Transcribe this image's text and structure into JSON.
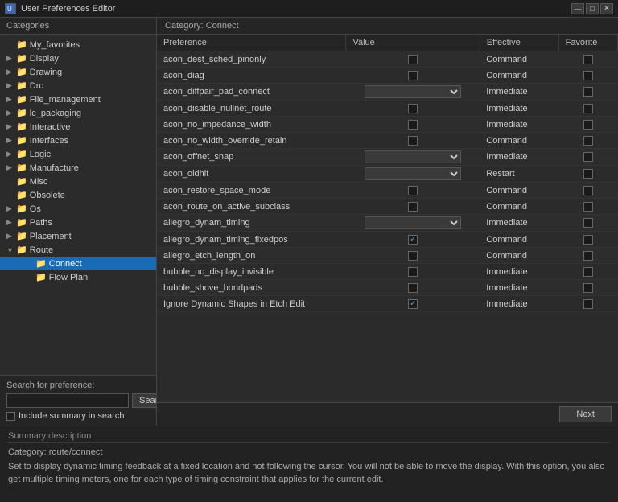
{
  "window": {
    "title": "User Preferences Editor",
    "controls": [
      "—",
      "□",
      "✕"
    ]
  },
  "sidebar": {
    "header": "Categories",
    "items": [
      {
        "id": "my_favorites",
        "label": "My_favorites",
        "indent": 1,
        "arrow": "",
        "type": "folder-yellow"
      },
      {
        "id": "display",
        "label": "Display",
        "indent": 1,
        "arrow": "▶",
        "type": "folder-yellow"
      },
      {
        "id": "drawing",
        "label": "Drawing",
        "indent": 1,
        "arrow": "▶",
        "type": "folder-yellow"
      },
      {
        "id": "drc",
        "label": "Drc",
        "indent": 1,
        "arrow": "▶",
        "type": "folder-yellow"
      },
      {
        "id": "file_management",
        "label": "File_management",
        "indent": 1,
        "arrow": "▶",
        "type": "folder-yellow"
      },
      {
        "id": "lc_packaging",
        "label": "lc_packaging",
        "indent": 1,
        "arrow": "▶",
        "type": "folder-yellow"
      },
      {
        "id": "interactive",
        "label": "Interactive",
        "indent": 1,
        "arrow": "▶",
        "type": "folder-yellow"
      },
      {
        "id": "interfaces",
        "label": "Interfaces",
        "indent": 1,
        "arrow": "▶",
        "type": "folder-yellow"
      },
      {
        "id": "logic",
        "label": "Logic",
        "indent": 1,
        "arrow": "▶",
        "type": "folder-yellow"
      },
      {
        "id": "manufacture",
        "label": "Manufacture",
        "indent": 1,
        "arrow": "▶",
        "type": "folder-yellow"
      },
      {
        "id": "misc",
        "label": "Misc",
        "indent": 1,
        "arrow": "",
        "type": "folder-yellow"
      },
      {
        "id": "obsolete",
        "label": "Obsolete",
        "indent": 1,
        "arrow": "",
        "type": "folder-yellow"
      },
      {
        "id": "os",
        "label": "Os",
        "indent": 1,
        "arrow": "▶",
        "type": "folder-yellow"
      },
      {
        "id": "paths",
        "label": "Paths",
        "indent": 1,
        "arrow": "▶",
        "type": "folder-yellow"
      },
      {
        "id": "placement",
        "label": "Placement",
        "indent": 1,
        "arrow": "▶",
        "type": "folder-yellow"
      },
      {
        "id": "route",
        "label": "Route",
        "indent": 1,
        "arrow": "▼",
        "type": "folder-yellow"
      },
      {
        "id": "connect",
        "label": "Connect",
        "indent": 2,
        "arrow": "",
        "type": "folder-blue",
        "selected": true
      },
      {
        "id": "flow_plan",
        "label": "Flow Plan",
        "indent": 2,
        "arrow": "",
        "type": "folder-yellow"
      }
    ],
    "search": {
      "label": "Search for preference:",
      "placeholder": "",
      "button_label": "Search",
      "include_label": "Include summary in search"
    }
  },
  "main": {
    "category_header": "Category:  Connect",
    "columns": [
      "Preference",
      "Value",
      "Effective",
      "Favorite"
    ],
    "preferences": [
      {
        "name": "acon_dest_sched_pinonly",
        "value_type": "checkbox",
        "checked": false,
        "effective": "Command",
        "favorite": false
      },
      {
        "name": "acon_diag",
        "value_type": "checkbox",
        "checked": false,
        "effective": "Command",
        "favorite": false
      },
      {
        "name": "acon_diffpair_pad_connect",
        "value_type": "select",
        "effective": "Immediate",
        "favorite": false
      },
      {
        "name": "acon_disable_nullnet_route",
        "value_type": "checkbox",
        "checked": false,
        "effective": "Immediate",
        "favorite": false
      },
      {
        "name": "acon_no_impedance_width",
        "value_type": "checkbox",
        "checked": false,
        "effective": "Immediate",
        "favorite": false
      },
      {
        "name": "acon_no_width_override_retain",
        "value_type": "checkbox",
        "checked": false,
        "effective": "Command",
        "favorite": false
      },
      {
        "name": "acon_offnet_snap",
        "value_type": "select",
        "effective": "Immediate",
        "favorite": false
      },
      {
        "name": "acon_oldhlt",
        "value_type": "select",
        "effective": "Restart",
        "favorite": false
      },
      {
        "name": "acon_restore_space_mode",
        "value_type": "checkbox",
        "checked": false,
        "effective": "Command",
        "favorite": false
      },
      {
        "name": "acon_route_on_active_subclass",
        "value_type": "checkbox",
        "checked": false,
        "effective": "Command",
        "favorite": false
      },
      {
        "name": "allegro_dynam_timing",
        "value_type": "select",
        "effective": "Immediate",
        "favorite": false
      },
      {
        "name": "allegro_dynam_timing_fixedpos",
        "value_type": "checkbox",
        "checked": true,
        "effective": "Command",
        "favorite": false
      },
      {
        "name": "allegro_etch_length_on",
        "value_type": "checkbox",
        "checked": false,
        "effective": "Command",
        "favorite": false
      },
      {
        "name": "bubble_no_display_invisible",
        "value_type": "checkbox",
        "checked": false,
        "effective": "Immediate",
        "favorite": false
      },
      {
        "name": "bubble_shove_bondpads",
        "value_type": "checkbox",
        "checked": false,
        "effective": "Immediate",
        "favorite": false
      },
      {
        "name": "Ignore Dynamic Shapes in Etch Edit",
        "value_type": "checkbox",
        "checked": true,
        "effective": "Immediate",
        "favorite": false
      }
    ],
    "next_button": "Next"
  },
  "summary": {
    "title": "Summary description",
    "category_line": "Category: route/connect",
    "description": "Set to display dynamic timing feedback at a fixed location and not following the cursor. You will not be able to move the display. With this option, you also get multiple timing\nmeters, one for each type of timing constraint that applies for the current edit."
  }
}
